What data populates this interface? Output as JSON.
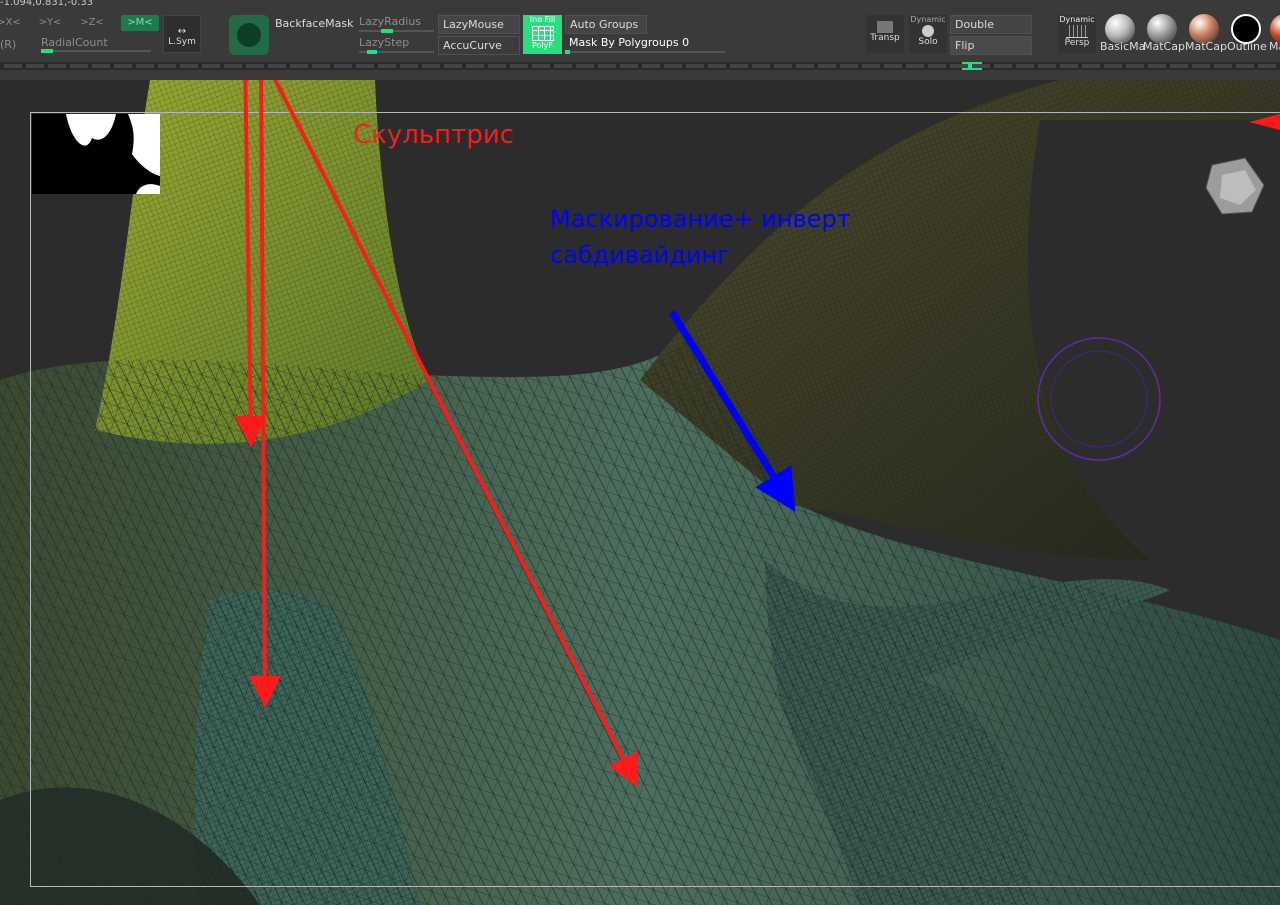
{
  "coords": "-1.094,0.831,-0.33",
  "sym": {
    "x": ">X<",
    "y": ">Y<",
    "z": ">Z<",
    "m": ">M<",
    "r": "(R)",
    "radial": "RadialCount",
    "lsym": "L.Sym"
  },
  "brush": {
    "backface": "BackfaceMask",
    "lazy_radius": "LazyRadius",
    "lazy_step": "LazyStep",
    "lazy_mouse": "LazyMouse",
    "accu_curve": "AccuCurve"
  },
  "polyfill": {
    "top": "Ino Fill",
    "bottom": "PolyF"
  },
  "groups": {
    "auto_groups": "Auto Groups",
    "mask_by_polygroups": "Mask By Polygroups 0",
    "mask_value": 0.03
  },
  "display": {
    "transp": "Transp",
    "dynamic": "Dynamic",
    "solo": "Solo",
    "double": "Double",
    "flip": "Flip",
    "persp_dynamic": "Dynamic",
    "persp": "Persp"
  },
  "materials": [
    {
      "label": "BasicMa",
      "color": "#b8b8b8"
    },
    {
      "label": "MatCap",
      "color": "#9a9a9a"
    },
    {
      "label": "MatCap",
      "color": "#c97a5a"
    },
    {
      "label": "Outline",
      "color": "#000000"
    },
    {
      "label": "Ma",
      "color": "#cc4422"
    }
  ],
  "annotations": {
    "red_label": "Скульптрис",
    "blue_line1": "Маскирование+ инверт",
    "blue_line2": "сабдивайдинг",
    "red_color": "#ff1a1a",
    "blue_color": "#0000ff"
  },
  "colors": {
    "accent": "#27e07d",
    "mesh_green": "#8a9a2a",
    "mesh_teal": "#3f6a5f"
  }
}
